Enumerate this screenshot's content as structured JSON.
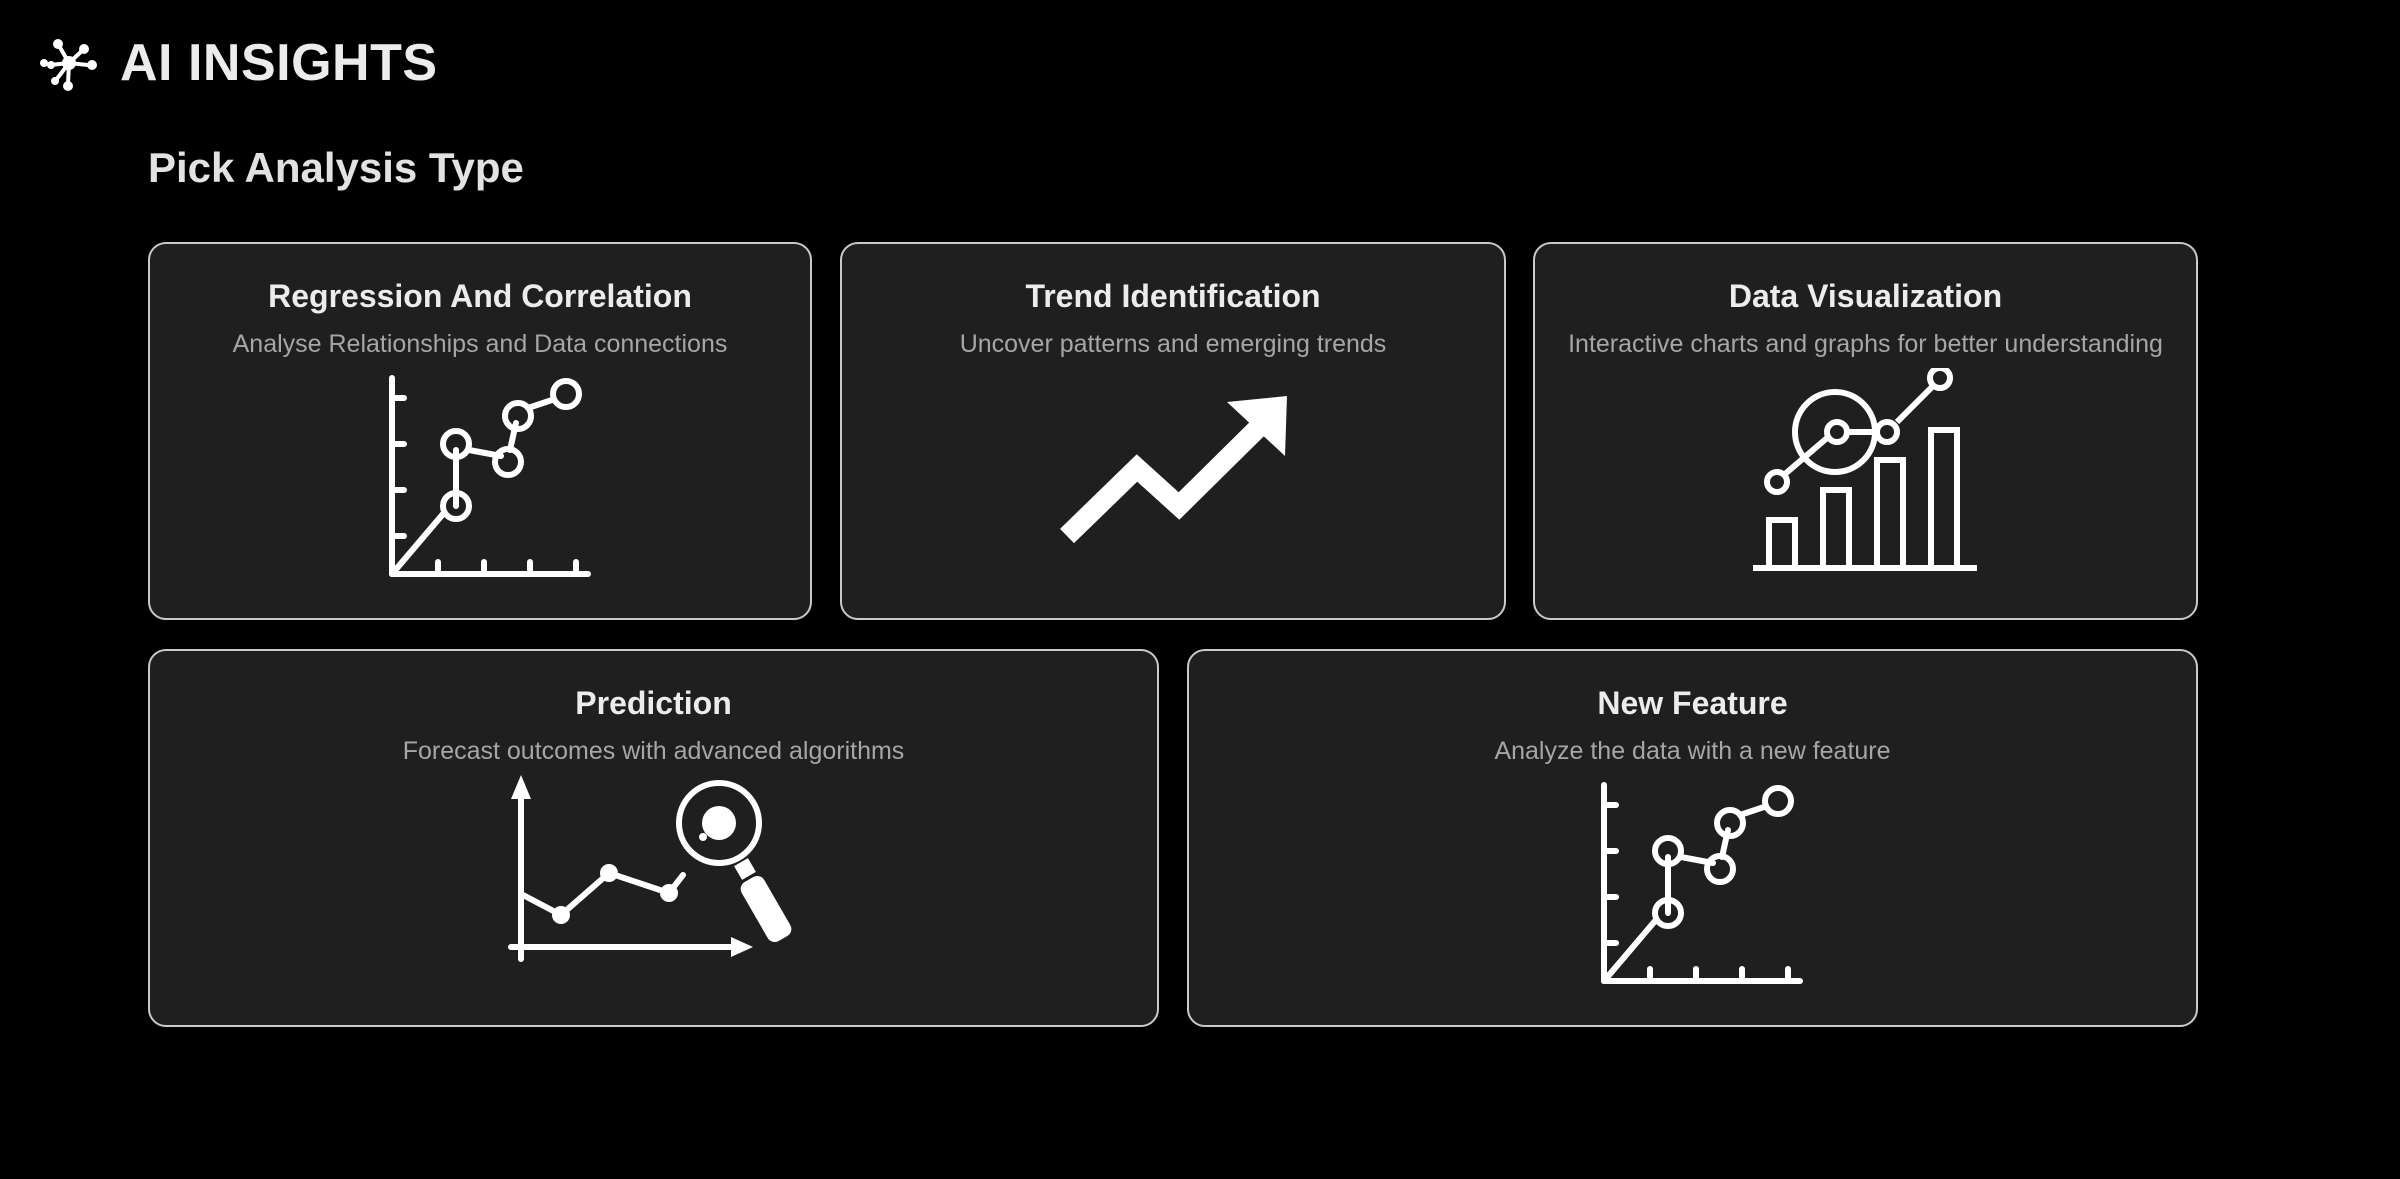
{
  "app": {
    "title": "AI INSIGHTS",
    "logo_icon": "network-nodes-icon"
  },
  "page": {
    "title": "Pick Analysis Type"
  },
  "cards": [
    {
      "title": "Regression And Correlation",
      "description": "Analyse Relationships and Data connections",
      "icon": "scatter-plot-icon"
    },
    {
      "title": "Trend Identification",
      "description": "Uncover patterns and emerging trends",
      "icon": "trend-arrow-icon"
    },
    {
      "title": "Data Visualization",
      "description": "Interactive charts and graphs for better understanding",
      "icon": "bar-chart-magnify-icon"
    },
    {
      "title": "Prediction",
      "description": "Forecast outcomes with advanced algorithms",
      "icon": "forecast-magnifier-icon"
    },
    {
      "title": "New Feature",
      "description": "Analyze the data with a new feature",
      "icon": "scatter-plot-icon"
    }
  ],
  "colors": {
    "background": "#000000",
    "card_background": "#1f1f1f",
    "card_border": "#c9c9c9",
    "title_text": "#ececec",
    "description_text": "#a6a6a6"
  }
}
